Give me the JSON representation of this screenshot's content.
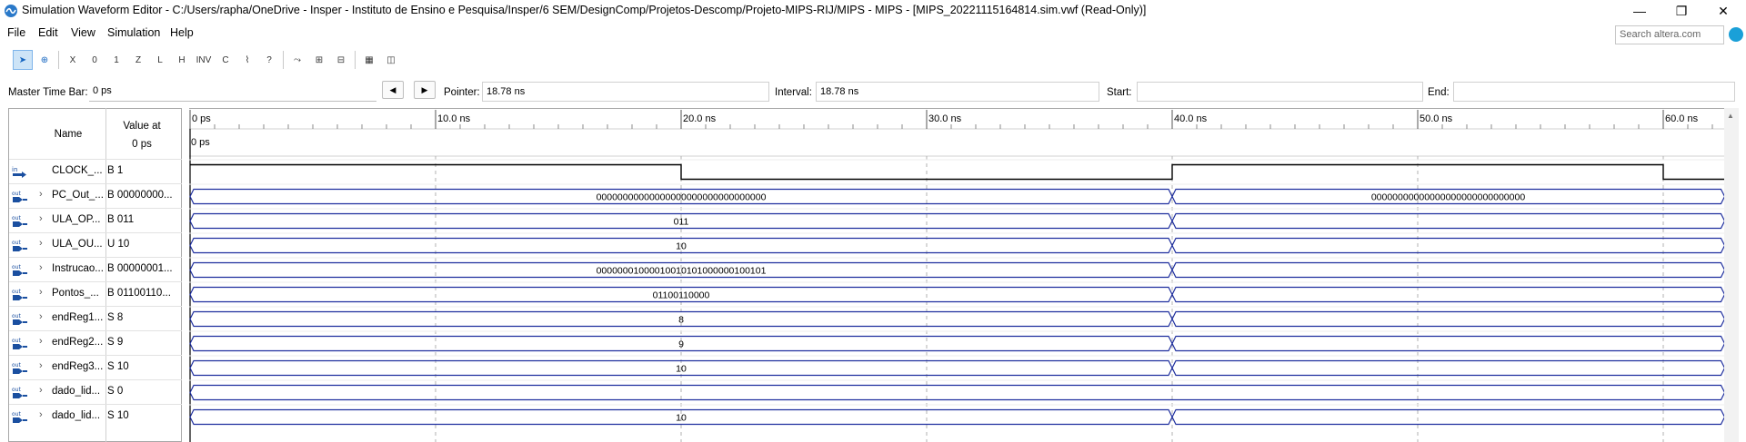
{
  "window": {
    "title": "Simulation Waveform Editor - C:/Users/rapha/OneDrive - Insper - Instituto de Ensino e Pesquisa/Insper/6 SEM/DesignComp/Projetos-Descomp/Projeto-MIPS-RIJ/MIPS - MIPS - [MIPS_20221115164814.sim.vwf (Read-Only)]",
    "controls": [
      "minimize-icon",
      "restore-icon",
      "close-icon"
    ]
  },
  "menu": {
    "items": [
      "File",
      "Edit",
      "View",
      "Simulation",
      "Help"
    ],
    "search_placeholder": "Search altera.com"
  },
  "toolbar": {
    "tools": [
      "pointer-icon",
      "zoom-icon",
      "sep",
      "unknown-icon",
      "force-low-icon",
      "force-high-icon",
      "high-impedance-icon",
      "weak-low-icon",
      "weak-high-icon",
      "invert-icon",
      "count-value-icon",
      "clock-icon",
      "random-icon",
      "sep",
      "snap-icon",
      "group-icon",
      "ungroup-icon",
      "sep",
      "grid-icon",
      "overwrite-icon"
    ]
  },
  "master": {
    "master_label": "Master Time Bar:",
    "master_value": "0 ps",
    "pointer_label": "Pointer:",
    "pointer_value": "18.78 ns",
    "interval_label": "Interval:",
    "interval_value": "18.78 ns",
    "start_label": "Start:",
    "start_value": "",
    "end_label": "End:",
    "end_value": ""
  },
  "grid": {
    "name_header": "Name",
    "value_header_1": "Value at",
    "value_header_2": "0 ps",
    "time_marker": "0 ps",
    "time_ticks": [
      "0 ps",
      "10.0 ns",
      "20.0 ns",
      "30.0 ns",
      "40.0 ns",
      "50.0 ns",
      "60.0 ns"
    ],
    "time_axis": {
      "start_ns": 0,
      "end_ns": 62.5,
      "major_step_ns": 10
    }
  },
  "signals": [
    {
      "type": "in",
      "name": "CLOCK_...",
      "value": "B 1",
      "bus": false,
      "clock": {
        "high": [
          [
            0,
            20
          ],
          [
            40,
            60
          ]
        ]
      }
    },
    {
      "type": "out",
      "name": "PC_Out_...",
      "value": "B 00000000...",
      "bus": true,
      "segments": [
        {
          "from": 0,
          "to": 40,
          "label": "00000000000000000000000000000000"
        },
        {
          "from": 40,
          "to": 62.5,
          "label": "00000000000000000000000000000"
        }
      ]
    },
    {
      "type": "out",
      "name": "ULA_OP...",
      "value": "B 011",
      "bus": true,
      "segments": [
        {
          "from": 0,
          "to": 40,
          "label": "011"
        },
        {
          "from": 40,
          "to": 62.5,
          "label": ""
        }
      ]
    },
    {
      "type": "out",
      "name": "ULA_OU...",
      "value": "U 10",
      "bus": true,
      "segments": [
        {
          "from": 0,
          "to": 40,
          "label": "10"
        },
        {
          "from": 40,
          "to": 62.5,
          "label": ""
        }
      ]
    },
    {
      "type": "out",
      "name": "Instrucao...",
      "value": "B 00000001...",
      "bus": true,
      "segments": [
        {
          "from": 0,
          "to": 40,
          "label": "00000001000010010101000000100101"
        },
        {
          "from": 40,
          "to": 62.5,
          "label": ""
        }
      ]
    },
    {
      "type": "out",
      "name": "Pontos_...",
      "value": "B 01100110...",
      "bus": true,
      "segments": [
        {
          "from": 0,
          "to": 40,
          "label": "01100110000"
        },
        {
          "from": 40,
          "to": 62.5,
          "label": ""
        }
      ]
    },
    {
      "type": "out",
      "name": "endReg1...",
      "value": "S 8",
      "bus": true,
      "segments": [
        {
          "from": 0,
          "to": 40,
          "label": "8"
        },
        {
          "from": 40,
          "to": 62.5,
          "label": ""
        }
      ]
    },
    {
      "type": "out",
      "name": "endReg2...",
      "value": "S 9",
      "bus": true,
      "segments": [
        {
          "from": 0,
          "to": 40,
          "label": "9"
        },
        {
          "from": 40,
          "to": 62.5,
          "label": ""
        }
      ]
    },
    {
      "type": "out",
      "name": "endReg3...",
      "value": "S 10",
      "bus": true,
      "segments": [
        {
          "from": 0,
          "to": 40,
          "label": "10"
        },
        {
          "from": 40,
          "to": 62.5,
          "label": ""
        }
      ]
    },
    {
      "type": "out",
      "name": "dado_lid...",
      "value": "S 0",
      "bus": true,
      "segments": [
        {
          "from": 0,
          "to": 62.5,
          "label": ""
        }
      ]
    },
    {
      "type": "out",
      "name": "dado_lid...",
      "value": "S 10",
      "bus": true,
      "segments": [
        {
          "from": 0,
          "to": 40,
          "label": "10"
        },
        {
          "from": 40,
          "to": 62.5,
          "label": ""
        }
      ]
    }
  ],
  "colors": {
    "wave": "#1f2f9e",
    "clock": "#000000",
    "grid_dash": "#b0b0b0",
    "bg": "#ffffff"
  }
}
